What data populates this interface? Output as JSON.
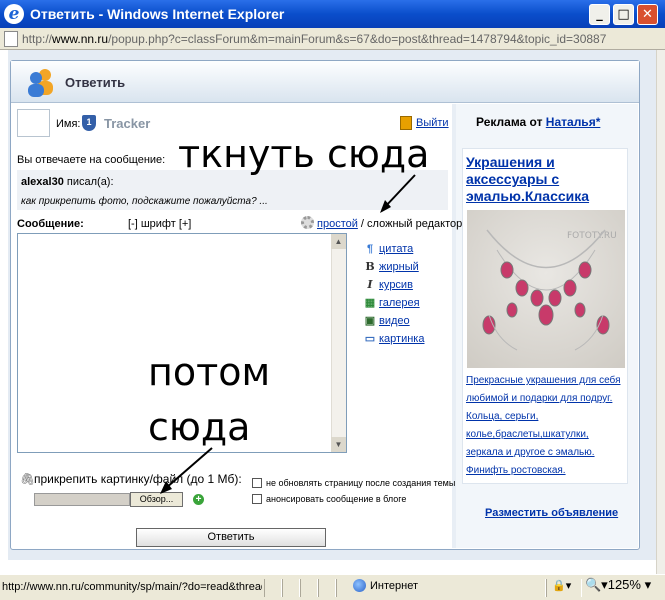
{
  "window": {
    "title": "Ответить - Windows Internet Explorer",
    "minimize": "_",
    "maximize": "□",
    "close": "✕"
  },
  "address": {
    "scheme": "http://",
    "host": "www.nn.ru",
    "path": "/popup.php?c=classForum&m=mainForum&s=67&do=post&thread=1478794&topic_id=30887"
  },
  "header": {
    "title": "Ответить"
  },
  "user": {
    "name_label": "Имя:",
    "name": "Tracker",
    "logout": "Выйти"
  },
  "reply": {
    "label": "Вы отвечаете на сообщение:",
    "author": "alexal30",
    "wrote": "писал(а):",
    "quote": "как прикрепить фото, подскажите пожалуйста? ..."
  },
  "editor": {
    "message_label": "Сообщение:",
    "font_prefix": "[-] шрифт [+]",
    "simple": "простой",
    "slash": " / ",
    "complex": "сложный редактор"
  },
  "tools": [
    {
      "icon": "¶",
      "label": "цитата"
    },
    {
      "icon": "B",
      "label": "жирный"
    },
    {
      "icon": "I",
      "label": "курсив"
    },
    {
      "icon": "▦",
      "label": "галерея"
    },
    {
      "icon": "▣",
      "label": "видео"
    },
    {
      "icon": "▭",
      "label": "картинка"
    }
  ],
  "attach": {
    "label": "прикрепить картинку/файл (до 1 Мб):",
    "browse": "Обзор...",
    "plus": "+"
  },
  "options": [
    {
      "label": "не обновлять страницу после создания темы"
    },
    {
      "label": "анонсировать сообщение в блоге"
    }
  ],
  "submit": "Ответить",
  "ad": {
    "title_prefix": "Реклама от ",
    "title_link": "Наталья*",
    "headline": "Украшения и аксессуары с эмалью.Классика",
    "watermark": "FOTOTY.RU",
    "lines": [
      "Прекрасные украшения для себя",
      "любимой и подарки для подруг.",
      "Кольца, серьги,",
      "колье,браслеты,шкатулки,",
      "зеркала и другое с эмалью.",
      "Финифть ростовская."
    ],
    "place": "Разместить объявление"
  },
  "annotations": {
    "first": "ткнуть сюда",
    "second_line1": "потом",
    "second_line2": "сюда"
  },
  "status": {
    "url": "http://www.nn.ru/community/sp/main/?do=read&thread=",
    "zone": "Интернет",
    "zoom": "125%"
  },
  "colors": {
    "title_bar": "#0a4ecb",
    "link": "#0033aa",
    "ad_gem": "#c83a6a"
  }
}
